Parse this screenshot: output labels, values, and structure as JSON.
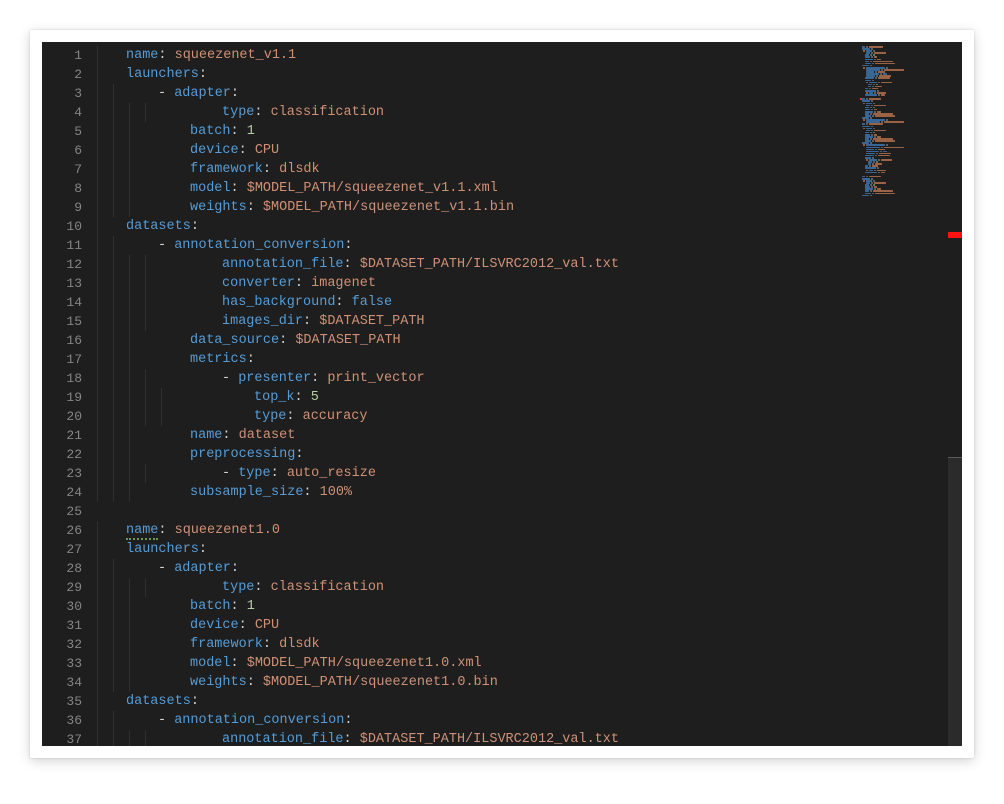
{
  "editor": {
    "lines": [
      {
        "indent": 1,
        "segs": [
          {
            "cls": "k",
            "t": "name"
          },
          {
            "cls": "p",
            "t": ": "
          },
          {
            "cls": "s",
            "t": "squeezenet_v1.1"
          }
        ]
      },
      {
        "indent": 1,
        "segs": [
          {
            "cls": "k",
            "t": "launchers"
          },
          {
            "cls": "p",
            "t": ":"
          }
        ]
      },
      {
        "indent": 2,
        "segs": [
          {
            "cls": "dash",
            "t": "- "
          },
          {
            "cls": "k",
            "t": "adapter"
          },
          {
            "cls": "p",
            "t": ":"
          }
        ]
      },
      {
        "indent": 4,
        "segs": [
          {
            "cls": "k",
            "t": "type"
          },
          {
            "cls": "p",
            "t": ": "
          },
          {
            "cls": "s",
            "t": "classification"
          }
        ]
      },
      {
        "indent": 3,
        "segs": [
          {
            "cls": "k",
            "t": "batch"
          },
          {
            "cls": "p",
            "t": ": "
          },
          {
            "cls": "n",
            "t": "1"
          }
        ]
      },
      {
        "indent": 3,
        "segs": [
          {
            "cls": "k",
            "t": "device"
          },
          {
            "cls": "p",
            "t": ": "
          },
          {
            "cls": "s",
            "t": "CPU"
          }
        ]
      },
      {
        "indent": 3,
        "segs": [
          {
            "cls": "k",
            "t": "framework"
          },
          {
            "cls": "p",
            "t": ": "
          },
          {
            "cls": "s",
            "t": "dlsdk"
          }
        ]
      },
      {
        "indent": 3,
        "segs": [
          {
            "cls": "k",
            "t": "model"
          },
          {
            "cls": "p",
            "t": ": "
          },
          {
            "cls": "s",
            "t": "$MODEL_PATH/squeezenet_v1.1.xml"
          }
        ]
      },
      {
        "indent": 3,
        "segs": [
          {
            "cls": "k",
            "t": "weights"
          },
          {
            "cls": "p",
            "t": ": "
          },
          {
            "cls": "s",
            "t": "$MODEL_PATH/squeezenet_v1.1.bin"
          }
        ]
      },
      {
        "indent": 1,
        "segs": [
          {
            "cls": "k",
            "t": "datasets"
          },
          {
            "cls": "p",
            "t": ":"
          }
        ]
      },
      {
        "indent": 2,
        "segs": [
          {
            "cls": "dash",
            "t": "- "
          },
          {
            "cls": "k",
            "t": "annotation_conversion"
          },
          {
            "cls": "p",
            "t": ":"
          }
        ]
      },
      {
        "indent": 4,
        "segs": [
          {
            "cls": "k",
            "t": "annotation_file"
          },
          {
            "cls": "p",
            "t": ": "
          },
          {
            "cls": "s",
            "t": "$DATASET_PATH/ILSVRC2012_val.txt"
          }
        ]
      },
      {
        "indent": 4,
        "segs": [
          {
            "cls": "k",
            "t": "converter"
          },
          {
            "cls": "p",
            "t": ": "
          },
          {
            "cls": "s",
            "t": "imagenet"
          }
        ]
      },
      {
        "indent": 4,
        "segs": [
          {
            "cls": "k",
            "t": "has_background"
          },
          {
            "cls": "p",
            "t": ": "
          },
          {
            "cls": "b",
            "t": "false"
          }
        ]
      },
      {
        "indent": 4,
        "segs": [
          {
            "cls": "k",
            "t": "images_dir"
          },
          {
            "cls": "p",
            "t": ": "
          },
          {
            "cls": "s",
            "t": "$DATASET_PATH"
          }
        ]
      },
      {
        "indent": 3,
        "segs": [
          {
            "cls": "k",
            "t": "data_source"
          },
          {
            "cls": "p",
            "t": ": "
          },
          {
            "cls": "s",
            "t": "$DATASET_PATH"
          }
        ]
      },
      {
        "indent": 3,
        "segs": [
          {
            "cls": "k",
            "t": "metrics"
          },
          {
            "cls": "p",
            "t": ":"
          }
        ]
      },
      {
        "indent": 4,
        "segs": [
          {
            "cls": "dash",
            "t": "- "
          },
          {
            "cls": "k",
            "t": "presenter"
          },
          {
            "cls": "p",
            "t": ": "
          },
          {
            "cls": "s",
            "t": "print_vector"
          }
        ]
      },
      {
        "indent": 5,
        "segs": [
          {
            "cls": "k",
            "t": "top_k"
          },
          {
            "cls": "p",
            "t": ": "
          },
          {
            "cls": "n",
            "t": "5"
          }
        ]
      },
      {
        "indent": 5,
        "segs": [
          {
            "cls": "k",
            "t": "type"
          },
          {
            "cls": "p",
            "t": ": "
          },
          {
            "cls": "s",
            "t": "accuracy"
          }
        ]
      },
      {
        "indent": 3,
        "segs": [
          {
            "cls": "k",
            "t": "name"
          },
          {
            "cls": "p",
            "t": ": "
          },
          {
            "cls": "s",
            "t": "dataset"
          }
        ]
      },
      {
        "indent": 3,
        "segs": [
          {
            "cls": "k",
            "t": "preprocessing"
          },
          {
            "cls": "p",
            "t": ":"
          }
        ]
      },
      {
        "indent": 4,
        "segs": [
          {
            "cls": "dash",
            "t": "- "
          },
          {
            "cls": "k",
            "t": "type"
          },
          {
            "cls": "p",
            "t": ": "
          },
          {
            "cls": "s",
            "t": "auto_resize"
          }
        ]
      },
      {
        "indent": 3,
        "segs": [
          {
            "cls": "k",
            "t": "subsample_size"
          },
          {
            "cls": "p",
            "t": ": "
          },
          {
            "cls": "s",
            "t": "100%"
          }
        ]
      },
      {
        "indent": 0,
        "segs": []
      },
      {
        "indent": 1,
        "segs": [
          {
            "cls": "k squiggle",
            "t": "name"
          },
          {
            "cls": "p",
            "t": ": "
          },
          {
            "cls": "s",
            "t": "squeezenet1.0"
          }
        ]
      },
      {
        "indent": 1,
        "segs": [
          {
            "cls": "k",
            "t": "launchers"
          },
          {
            "cls": "p",
            "t": ":"
          }
        ]
      },
      {
        "indent": 2,
        "segs": [
          {
            "cls": "dash",
            "t": "- "
          },
          {
            "cls": "k",
            "t": "adapter"
          },
          {
            "cls": "p",
            "t": ":"
          }
        ]
      },
      {
        "indent": 4,
        "segs": [
          {
            "cls": "k",
            "t": "type"
          },
          {
            "cls": "p",
            "t": ": "
          },
          {
            "cls": "s",
            "t": "classification"
          }
        ]
      },
      {
        "indent": 3,
        "segs": [
          {
            "cls": "k",
            "t": "batch"
          },
          {
            "cls": "p",
            "t": ": "
          },
          {
            "cls": "n",
            "t": "1"
          }
        ]
      },
      {
        "indent": 3,
        "segs": [
          {
            "cls": "k",
            "t": "device"
          },
          {
            "cls": "p",
            "t": ": "
          },
          {
            "cls": "s",
            "t": "CPU"
          }
        ]
      },
      {
        "indent": 3,
        "segs": [
          {
            "cls": "k",
            "t": "framework"
          },
          {
            "cls": "p",
            "t": ": "
          },
          {
            "cls": "s",
            "t": "dlsdk"
          }
        ]
      },
      {
        "indent": 3,
        "segs": [
          {
            "cls": "k",
            "t": "model"
          },
          {
            "cls": "p",
            "t": ": "
          },
          {
            "cls": "s",
            "t": "$MODEL_PATH/squeezenet1.0.xml"
          }
        ]
      },
      {
        "indent": 3,
        "segs": [
          {
            "cls": "k",
            "t": "weights"
          },
          {
            "cls": "p",
            "t": ": "
          },
          {
            "cls": "s",
            "t": "$MODEL_PATH/squeezenet1.0.bin"
          }
        ]
      },
      {
        "indent": 1,
        "segs": [
          {
            "cls": "k",
            "t": "datasets"
          },
          {
            "cls": "p",
            "t": ":"
          }
        ]
      },
      {
        "indent": 2,
        "segs": [
          {
            "cls": "dash",
            "t": "- "
          },
          {
            "cls": "k",
            "t": "annotation_conversion"
          },
          {
            "cls": "p",
            "t": ":"
          }
        ]
      },
      {
        "indent": 4,
        "segs": [
          {
            "cls": "k",
            "t": "annotation_file"
          },
          {
            "cls": "p",
            "t": ": "
          },
          {
            "cls": "s",
            "t": "$DATASET_PATH/ILSVRC2012_val.txt"
          }
        ]
      }
    ],
    "first_line_number": 1,
    "indent_guide_cols": [
      0,
      16,
      32,
      48,
      64
    ],
    "minimap_error_line": 26,
    "scrollbar": {
      "error_offset_frac": 0.27,
      "viewport_top_frac": 0.59,
      "viewport_height_frac": 0.41
    }
  }
}
